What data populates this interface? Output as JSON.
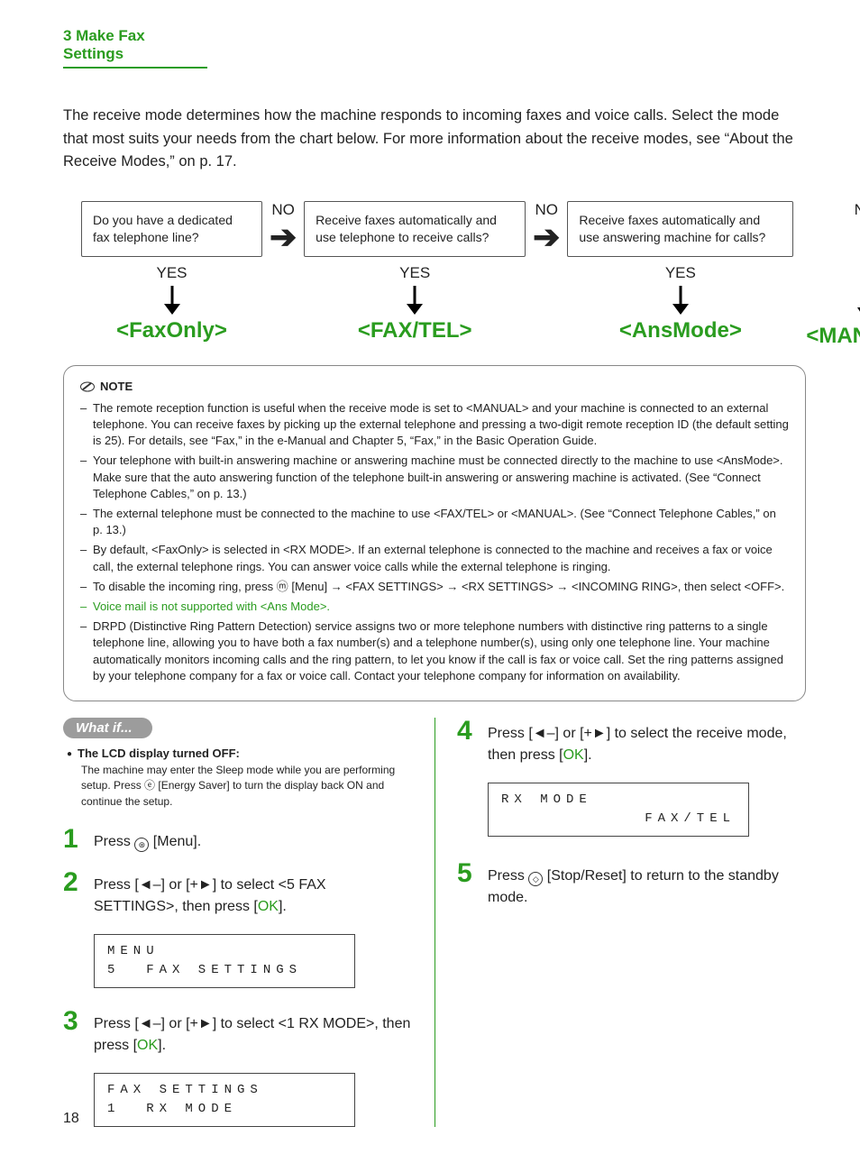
{
  "header": "3 Make Fax Settings",
  "intro": "The receive mode determines how the machine responds to incoming faxes and voice calls. Select the mode that most suits your needs from the chart below. For more information about the receive modes, see “About the Receive Modes,” on p. 17.",
  "flow": {
    "no": "NO",
    "yes": "YES",
    "q1": "Do you have a dedicated fax telephone line?",
    "q2": "Receive faxes automatically and use telephone to receive calls?",
    "q3": "Receive faxes automatically and use answering machine for calls?",
    "m1": "<FaxOnly>",
    "m2": "<FAX/TEL>",
    "m3": "<AnsMode>",
    "m4": "<MANUAL>"
  },
  "note": {
    "title": "NOTE",
    "items": [
      "The remote reception function is useful when the receive mode is set to <MANUAL> and your machine is connected to an external telephone. You can receive faxes by picking up the external telephone and pressing a two-digit remote reception ID (the default setting is 25). For details, see “Fax,” in the e-Manual and Chapter 5, “Fax,” in the Basic Operation Guide.",
      "Your telephone with built-in answering machine or answering machine must be connected directly to the machine to use <AnsMode>. Make sure that the auto answering function of the telephone built-in answering or answering machine is activated. (See “Connect Telephone Cables,” on p. 13.)",
      "The external telephone must be connected to the machine to use <FAX/TEL> or <MANUAL>. (See “Connect Telephone Cables,” on p. 13.)",
      "By default, <FaxOnly> is selected in <RX MODE>. If an external telephone is connected to the machine and receives a fax or voice call, the external telephone rings. You can answer voice calls while the external telephone is ringing.",
      "To disable the incoming ring, press ⓜ [Menu] → <FAX SETTINGS> → <RX SETTINGS> → <INCOMING RING>, then select <OFF>.",
      "Voice mail is not supported with <Ans Mode>.",
      "DRPD (Distinctive Ring Pattern Detection) service assigns two or more telephone numbers with distinctive ring patterns to a single telephone line, allowing you to have both a fax number(s) and a telephone number(s), using only one telephone line. Your machine automatically monitors incoming calls and the ring pattern, to let you know if the call is fax or voice call. Set the ring patterns assigned by your telephone company for a fax or voice call. Contact your telephone company for information on availability."
    ]
  },
  "whatif": {
    "title": "What if...",
    "heading": "The LCD display turned OFF:",
    "body": "The machine may enter the Sleep mode while you are performing setup. Press ⓔ [Energy Saver] to turn the display back ON and continue the setup."
  },
  "steps": {
    "s1": {
      "num": "1",
      "pre": "Press ",
      "post": " [Menu]."
    },
    "s2": {
      "num": "2",
      "text_a": "Press [◄–] or [+►] to select <5 FAX SETTINGS>, then press [",
      "ok": "OK",
      "text_b": "].",
      "lcd1": "MENU",
      "lcd2": "5  FAX SETTINGS"
    },
    "s3": {
      "num": "3",
      "text_a": "Press [◄–] or [+►] to select <1 RX MODE>, then press [",
      "ok": "OK",
      "text_b": "].",
      "lcd1": "FAX SETTINGS",
      "lcd2": "1  RX MODE"
    },
    "s4": {
      "num": "4",
      "text_a": "Press [◄–] or [+►] to select the receive mode, then press [",
      "ok": "OK",
      "text_b": "].",
      "lcd1": "RX MODE",
      "lcd2": "FAX/TEL"
    },
    "s5": {
      "num": "5",
      "pre": "Press ",
      "post": " [Stop/Reset] to return to the standby mode."
    }
  },
  "pagenum": "18"
}
